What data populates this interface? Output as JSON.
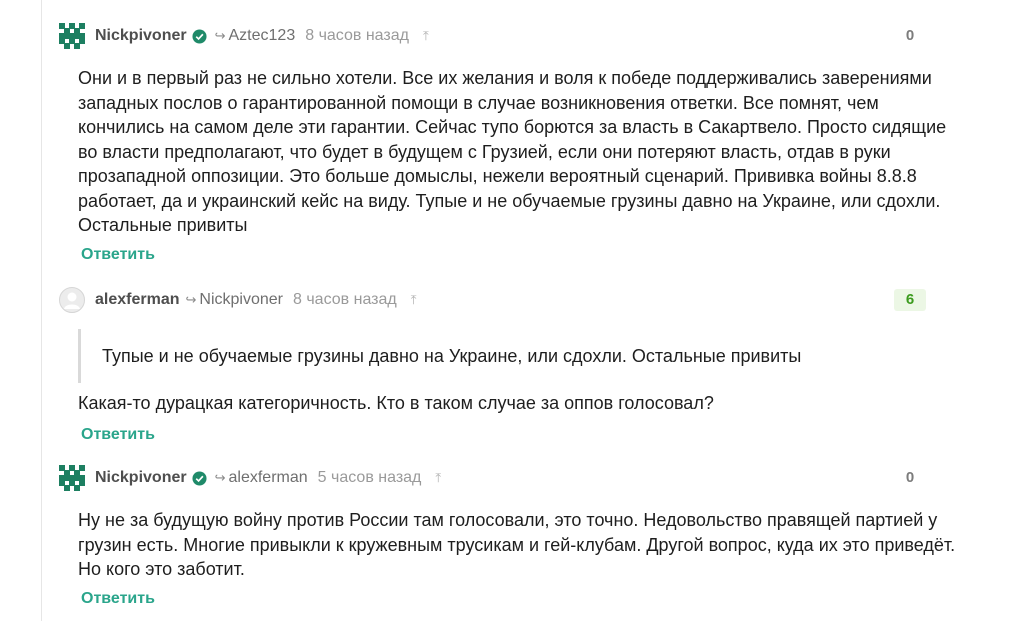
{
  "comments": [
    {
      "author": "Nickpivoner",
      "reply_to": "Aztec123",
      "time": "8 часов назад",
      "rating": "0",
      "text": "Они и в первый раз не сильно хотели. Все их желания и воля к победе поддерживались заверениями западных послов о гарантированной помощи в случае возникновения ответки. Все помнят, чем кончились на самом деле эти гарантии. Сейчас тупо борются за власть в Сакартвело. Просто сидящие во власти предполагают, что будет в будущем с Грузией, если они потеряют власть, отдав в руки прозападной оппозиции. Это больше домыслы, нежели вероятный сценарий. Прививка войны 8.8.8 работает, да и украинский кейс на виду. Тупые и не обучаемые грузины давно на Украине, или сдохли. Остальные привиты",
      "reply_label": "Ответить"
    },
    {
      "author": "alexferman",
      "reply_to": "Nickpivoner",
      "time": "8 часов назад",
      "rating": "6",
      "quote": "Тупые и не обучаемые грузины давно на Украине, или сдохли. Остальные привиты",
      "text": "Какая-то дурацкая категоричность. Кто в таком случае за оппов голосовал?",
      "reply_label": "Ответить"
    },
    {
      "author": "Nickpivoner",
      "reply_to": "alexferman",
      "time": "5 часов назад",
      "rating": "0",
      "text": "Ну не за будущую войну против России там голосовали, это точно. Недовольство правящей партией у грузин есть. Многие привыкли к кружевным трусикам и гей-клубам. Другой вопрос, куда их это приведёт. Но кого это заботит.",
      "reply_label": "Ответить"
    }
  ],
  "icons": {
    "reply_arrow": "↪",
    "pin": "⤒"
  },
  "colors": {
    "accent": "#2aa58b",
    "avatar_green": "#1d7f61",
    "verified": "#1f8a69",
    "rating_positive": "#3c9b1e",
    "rating_positive_bg": "#ecf7e5"
  }
}
